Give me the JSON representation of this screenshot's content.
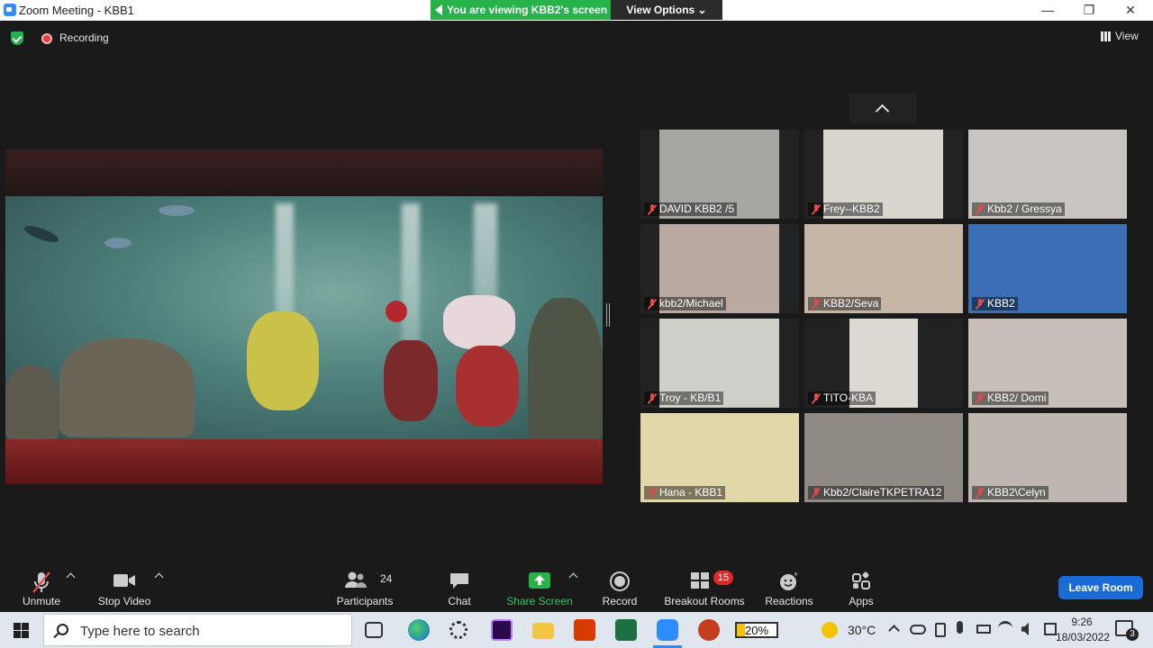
{
  "window": {
    "title": "Zoom Meeting - KBB1",
    "controls": [
      "—",
      "❐",
      "✕"
    ]
  },
  "share_banner": {
    "status": "You are viewing KBB2's screen",
    "view_options": "View Options ⌄"
  },
  "topbar": {
    "recording_label": "Recording",
    "view_label": "View"
  },
  "gallery": {
    "tiles": [
      {
        "name": "DAVID KBB2 /5",
        "bg": "#a8a6a2"
      },
      {
        "name": "Frey--KBB2",
        "bg": "#d8d5cf"
      },
      {
        "name": "Kbb2 / Gressya",
        "bg": "#c9c6c2"
      },
      {
        "name": "kbb2/Michael",
        "bg": "#b9a9a0"
      },
      {
        "name": "KBB2/Seva",
        "bg": "#c6b6a6"
      },
      {
        "name": "KBB2",
        "bg": "#3a6fb6"
      },
      {
        "name": "Troy - KB/B1",
        "bg": "#cfcfca"
      },
      {
        "name": "TITO-KBA",
        "bg": "#dcd8d2"
      },
      {
        "name": "KBB2/ Domi",
        "bg": "#c7bfb7"
      },
      {
        "name": "Hana - KBB1",
        "bg": "#e2d7a8"
      },
      {
        "name": "Kbb2/ClaireTKPETRA12",
        "bg": "#8f8a84"
      },
      {
        "name": "KBB2\\Celyn",
        "bg": "#bdb7b0"
      }
    ]
  },
  "toolbar": {
    "unmute": "Unmute",
    "stop_video": "Stop Video",
    "participants": "Participants",
    "participants_count": "24",
    "chat": "Chat",
    "share_screen": "Share Screen",
    "record": "Record",
    "breakout_rooms": "Breakout Rooms",
    "breakout_badge": "15",
    "reactions": "Reactions",
    "apps": "Apps",
    "leave_room": "Leave Room"
  },
  "taskbar": {
    "search_placeholder": "Type here to search",
    "battery": "20%",
    "temperature": "30°C",
    "time": "9:26",
    "date": "18/03/2022",
    "notifications": "3"
  },
  "colors": {
    "zoom_blue": "#2d8cff",
    "share_green": "#27b24a",
    "leave_blue": "#1a6bd6",
    "muted_red": "#e14a4a"
  }
}
